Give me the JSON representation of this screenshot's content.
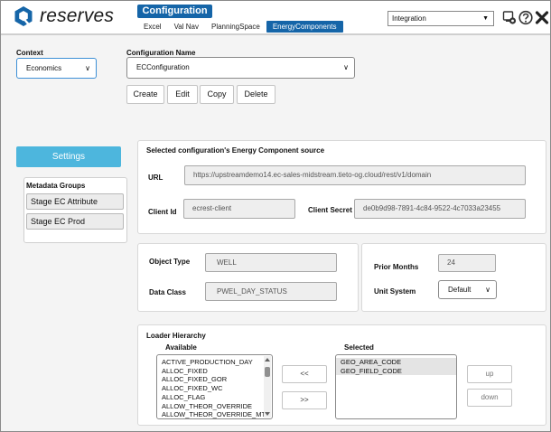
{
  "header": {
    "logo_text": "reserves",
    "config_title": "Configuration",
    "tabs": [
      {
        "label": "Excel"
      },
      {
        "label": "Val Nav"
      },
      {
        "label": "PlanningSpace"
      },
      {
        "label": "EnergyComponents",
        "active": true
      }
    ],
    "environment": "Integration",
    "icons": [
      "network-settings-icon",
      "help-icon",
      "close-icon"
    ]
  },
  "context": {
    "label": "Context",
    "value": "Economics"
  },
  "configuration": {
    "label": "Configuration Name",
    "value": "ECConfiguration",
    "buttons": {
      "create": "Create",
      "edit": "Edit",
      "copy": "Copy",
      "delete": "Delete"
    }
  },
  "sidebar": {
    "settings_label": "Settings",
    "metadata_label": "Metadata Groups",
    "items": [
      {
        "label": "Stage EC Attribute"
      },
      {
        "label": "Stage EC Prod"
      }
    ]
  },
  "source": {
    "title": "Selected configuration's Energy Component source",
    "url_label": "URL",
    "url_value": "https://upstreamdemo14.ec-sales-midstream.tieto-og.cloud/rest/v1/domain",
    "client_id_label": "Client Id",
    "client_id_value": "ecrest-client",
    "client_secret_label": "Client Secret",
    "client_secret_value": "de0b9d98-7891-4c84-9522-4c7033a23455"
  },
  "object": {
    "object_type_label": "Object Type",
    "object_type_value": "WELL",
    "data_class_label": "Data Class",
    "data_class_value": "PWEL_DAY_STATUS"
  },
  "period": {
    "prior_months_label": "Prior Months",
    "prior_months_value": "24",
    "unit_system_label": "Unit System",
    "unit_system_value": "Default"
  },
  "loader": {
    "title": "Loader Hierarchy",
    "available_label": "Available",
    "selected_label": "Selected",
    "available": [
      "ACTIVE_PRODUCTION_DAY",
      "ALLOC_FIXED",
      "ALLOC_FIXED_GOR",
      "ALLOC_FIXED_WC",
      "ALLOC_FLAG",
      "ALLOW_THEOR_OVERRIDE",
      "ALLOW_THEOR_OVERRIDE_MTH"
    ],
    "selected": [
      "GEO_AREA_CODE",
      "GEO_FIELD_CODE"
    ],
    "move_left": "<<",
    "move_right": ">>",
    "up": "up",
    "down": "down"
  },
  "colors": {
    "accent": "#1565a8",
    "settings": "#4db6dd"
  }
}
